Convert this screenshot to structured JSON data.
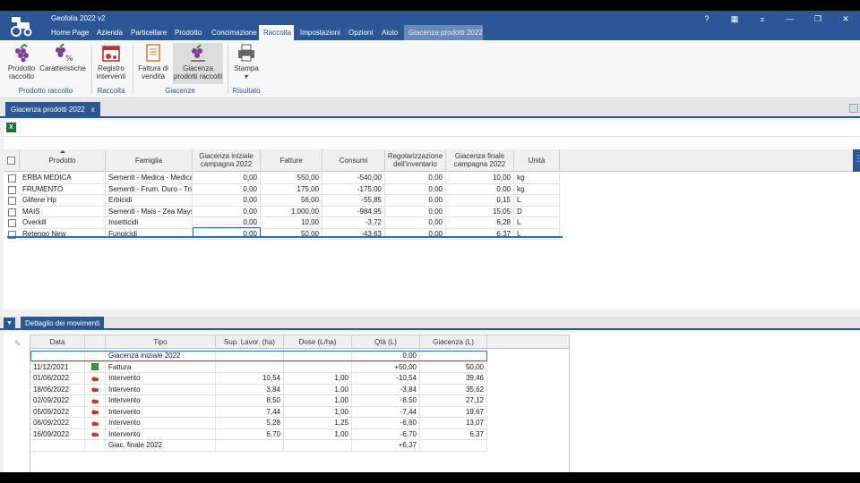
{
  "window": {
    "title": "Geofolia 2022 v2",
    "controls": [
      "?",
      "▦",
      "⌅",
      "—",
      "❐",
      "✕"
    ]
  },
  "ribbon_tabs": [
    {
      "label": "Home Page"
    },
    {
      "label": "Azienda"
    },
    {
      "label": "Particellare"
    },
    {
      "label": "Prodotto"
    },
    {
      "label": "Concimazione"
    },
    {
      "label": "Raccolta",
      "active": true
    },
    {
      "label": "Impostazioni"
    },
    {
      "label": "Opzioni"
    },
    {
      "label": "Aiuto"
    },
    {
      "label": "Giacenza prodotti 2022",
      "context": true
    }
  ],
  "ribbon": {
    "buttons": [
      {
        "label_line1": "Prodotto",
        "label_line2": "raccolto",
        "icon": "grapes-icon"
      },
      {
        "label_line1": "Caratteristiche",
        "label_line2": "",
        "icon": "grapes-percent-icon"
      },
      {
        "label_line1": "Registro",
        "label_line2": "interventi",
        "icon": "calendar-tractor-icon"
      },
      {
        "label_line1": "Fattura di",
        "label_line2": "vendita",
        "icon": "invoice-icon"
      },
      {
        "label_line1": "Giacenza",
        "label_line2": "prodotti raccolti",
        "icon": "grapes-stock-icon"
      },
      {
        "label_line1": "Stampa",
        "label_line2": "▾",
        "icon": "printer-icon"
      }
    ],
    "groups": [
      "Prodotto raccolto",
      "Raccolta",
      "Giacenze",
      "Risultato"
    ]
  },
  "doc_tab": {
    "label": "Giacenza prodotti 2022",
    "close": "x"
  },
  "excel_label": "X",
  "grid1": {
    "columns": [
      {
        "label": "Prodotto"
      },
      {
        "label": "Famiglia"
      },
      {
        "label": "Giacenza iniziale campagna 2022"
      },
      {
        "label": "Fatture"
      },
      {
        "label": "Consumi"
      },
      {
        "label": "Regolarizzazione dell'inventario"
      },
      {
        "label": "Giacenza finale campagna 2022"
      },
      {
        "label": "Unità"
      }
    ],
    "rows": [
      [
        "ERBA MEDICA",
        "Sementi - Medica - Medicago",
        "0,00",
        "550,00",
        "-540,00",
        "0,00",
        "10,00",
        "kg"
      ],
      [
        "FRUMENTO",
        "Sementi - Frum. Duro - Triticum",
        "0,00",
        "175,00",
        "-175,00",
        "0,00",
        "0,00",
        "kg"
      ],
      [
        "Glifene Hp",
        "Erbicidi",
        "0,00",
        "56,00",
        "-55,85",
        "0,00",
        "0,15",
        "L"
      ],
      [
        "MAIS",
        "Sementi - Mais - Zea Mays",
        "0,00",
        "1.000,00",
        "-984,95",
        "0,00",
        "15,05",
        "D"
      ],
      [
        "Overkill",
        "Insetticidi",
        "0,00",
        "10,00",
        "-3,72",
        "0,00",
        "6,28",
        "L"
      ],
      [
        "Retengo New",
        "Fungicidi",
        "0,00",
        "50,00",
        "-43,63",
        "0,00",
        "6,37",
        "L"
      ]
    ]
  },
  "detail": {
    "toggle": "▼",
    "tab_label": "Dettaglio dei movimenti",
    "columns": [
      "Data",
      "",
      "Tipo",
      "Sup. Lavor. (ha)",
      "Dose (L/ha)",
      "Qtà (L)",
      "Giacenza (L)"
    ],
    "rows": [
      {
        "data": "",
        "icon": "",
        "tipo": "Giacenza iniziale 2022",
        "sup": "",
        "dose": "",
        "qta": "0,00",
        "giac": ""
      },
      {
        "data": "11/12/2021",
        "icon": "invoice-row-icon",
        "tipo": "Fattura",
        "sup": "",
        "dose": "",
        "qta": "+50,00",
        "giac": "50,00"
      },
      {
        "data": "01/06/2022",
        "icon": "tractor-row-icon",
        "tipo": "Intervento",
        "sup": "10,54",
        "dose": "1,00",
        "qta": "-10,54",
        "giac": "39,46"
      },
      {
        "data": "18/06/2022",
        "icon": "tractor-row-icon",
        "tipo": "Intervento",
        "sup": "3,84",
        "dose": "1,00",
        "qta": "-3,84",
        "giac": "35,62"
      },
      {
        "data": "02/09/2022",
        "icon": "tractor-row-icon",
        "tipo": "Intervento",
        "sup": "8,50",
        "dose": "1,00",
        "qta": "-8,50",
        "giac": "27,12"
      },
      {
        "data": "05/09/2022",
        "icon": "tractor-row-icon",
        "tipo": "Intervento",
        "sup": "7,44",
        "dose": "1,00",
        "qta": "-7,44",
        "giac": "19,67"
      },
      {
        "data": "06/09/2022",
        "icon": "tractor-row-icon",
        "tipo": "Intervento",
        "sup": "5,28",
        "dose": "1,25",
        "qta": "-6,60",
        "giac": "13,07"
      },
      {
        "data": "16/09/2022",
        "icon": "tractor-row-icon",
        "tipo": "Intervento",
        "sup": "6,70",
        "dose": "1,00",
        "qta": "-6,70",
        "giac": "6,37"
      },
      {
        "data": "",
        "icon": "",
        "tipo": "Giac. finale 2022",
        "sup": "",
        "dose": "",
        "qta": "+6,37",
        "giac": ""
      }
    ]
  },
  "colors": {
    "accent": "#2b5797",
    "focus": "#2b6cc4"
  }
}
